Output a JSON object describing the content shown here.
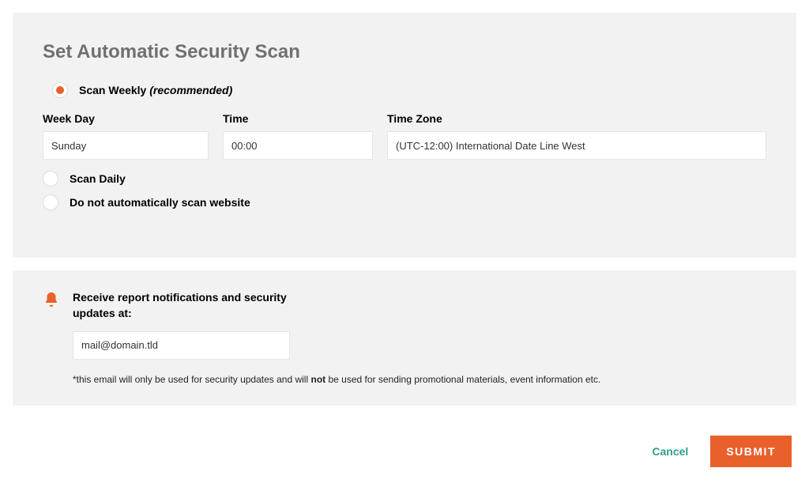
{
  "title": "Set Automatic Security Scan",
  "radios": {
    "weekly": {
      "label": "Scan Weekly ",
      "rec": "(recommended)"
    },
    "daily": {
      "label": "Scan Daily"
    },
    "none": {
      "label": "Do not automatically scan website"
    }
  },
  "fields": {
    "weekday": {
      "label": "Week Day",
      "value": "Sunday"
    },
    "time": {
      "label": "Time",
      "value": "00:00"
    },
    "timezone": {
      "label": "Time Zone",
      "value": "(UTC-12:00) International Date Line West"
    }
  },
  "notif": {
    "title": "Receive report notifications and security updates at:",
    "email": "mail@domain.tld",
    "disclaimer_pre": "*this email will only be used for security updates and will ",
    "disclaimer_bold": "not",
    "disclaimer_post": " be used for sending promotional materials, event information etc."
  },
  "buttons": {
    "cancel": "Cancel",
    "submit": "SUBMIT"
  }
}
